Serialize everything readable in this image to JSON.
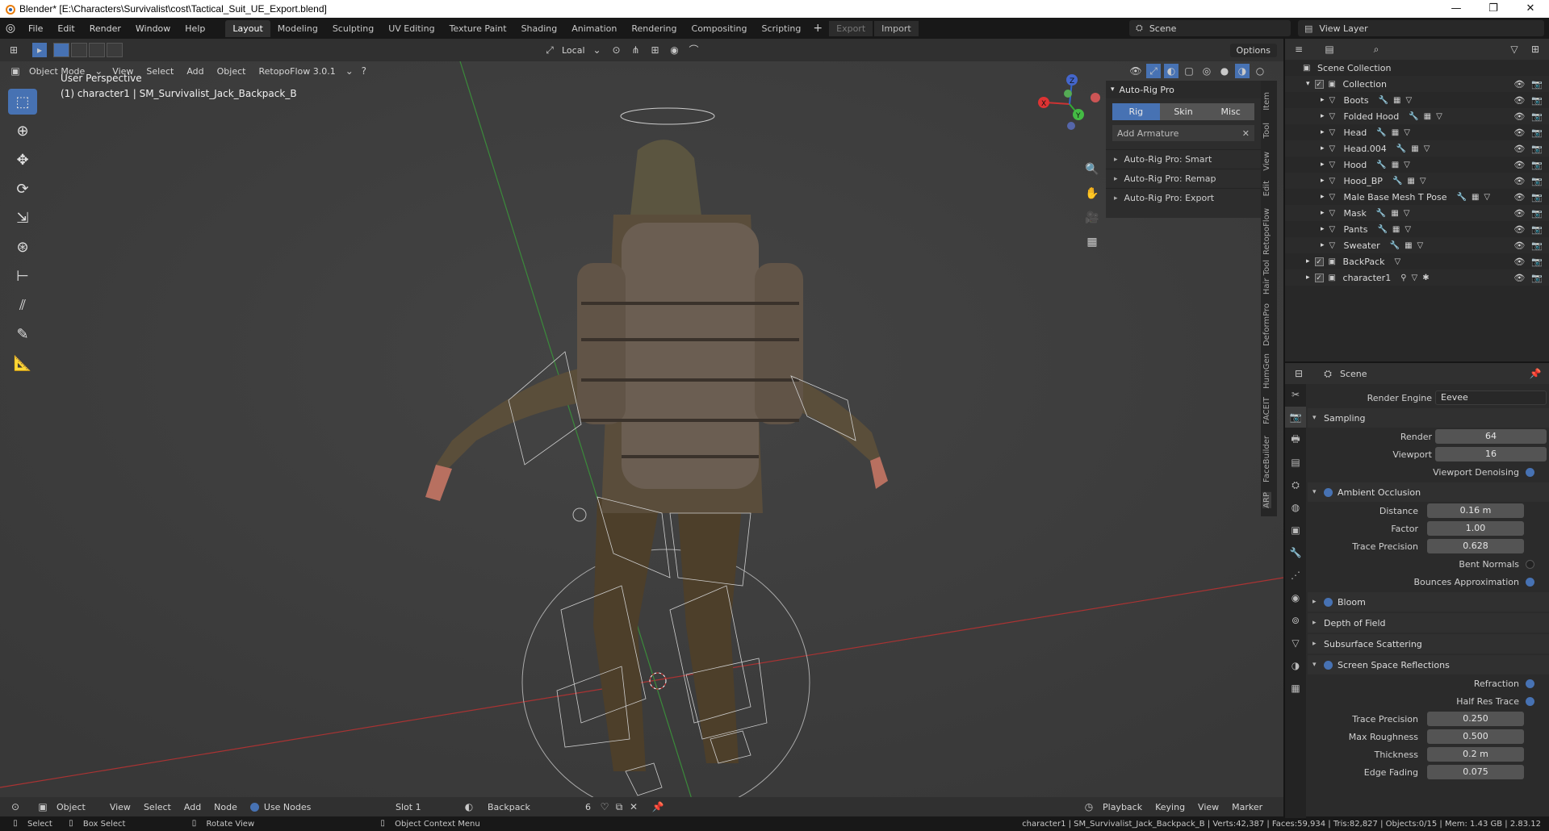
{
  "window": {
    "title": "Blender* [E:\\Characters\\Survivalist\\cost\\Tactical_Suit_UE_Export.blend]",
    "controls": [
      "—",
      "❐",
      "✕"
    ]
  },
  "menubar": {
    "menus": [
      "File",
      "Edit",
      "Render",
      "Window",
      "Help"
    ],
    "workspaces": [
      "Layout",
      "Modeling",
      "Sculpting",
      "UV Editing",
      "Texture Paint",
      "Shading",
      "Animation",
      "Rendering",
      "Compositing",
      "Scripting"
    ],
    "active_workspace": "Layout",
    "export_label": "Export",
    "import_label": "Import",
    "scene": "Scene",
    "view_layer": "View Layer"
  },
  "viewport_header": {
    "transform_orientation": "Local",
    "options": "Options",
    "mode": "Object Mode",
    "menus": [
      "View",
      "Select",
      "Add",
      "Object"
    ],
    "retopoflow": "RetopoFlow 3.0.1"
  },
  "viewport": {
    "perspective": "User Perspective",
    "active_object": "(1) character1 | SM_Survivalist_Jack_Backpack_B"
  },
  "npanel": {
    "title": "Auto-Rig Pro",
    "tabs": [
      "Rig",
      "Skin",
      "Misc"
    ],
    "active_tab": "Rig",
    "add_armature": "Add Armature",
    "subpanels": [
      "Auto-Rig Pro: Smart",
      "Auto-Rig Pro: Remap",
      "Auto-Rig Pro: Export"
    ],
    "side_tabs": [
      "Item",
      "Tool",
      "View",
      "Edit",
      "RetopoFlow",
      "Hair Tool",
      "DeformPro",
      "HumGen",
      "FACEIT",
      "FaceBuilder",
      "ARP"
    ]
  },
  "bottom_header": {
    "editor": "Object",
    "menus": [
      "View",
      "Select",
      "Add",
      "Node"
    ],
    "use_nodes": "Use Nodes",
    "slot": "Slot 1",
    "material": "Backpack",
    "users": "6",
    "playback": "Playback",
    "keying": "Keying",
    "view": "View",
    "marker": "Marker"
  },
  "statusbar": {
    "select": "Select",
    "box_select": "Box Select",
    "rotate_view": "Rotate View",
    "context_menu": "Object Context Menu",
    "stats": "character1 | SM_Survivalist_Jack_Backpack_B | Verts:42,387 | Faces:59,934 | Tris:82,827 | Objects:0/15 | Mem: 1.43 GB | 2.83.12"
  },
  "outliner": {
    "root": "Scene Collection",
    "collection": "Collection",
    "items": [
      {
        "name": "Boots"
      },
      {
        "name": "Folded Hood"
      },
      {
        "name": "Head"
      },
      {
        "name": "Head.004"
      },
      {
        "name": "Hood"
      },
      {
        "name": "Hood_BP"
      },
      {
        "name": "Male Base Mesh T Pose"
      },
      {
        "name": "Mask"
      },
      {
        "name": "Pants"
      },
      {
        "name": "Sweater"
      }
    ],
    "top_level": [
      {
        "name": "BackPack"
      },
      {
        "name": "character1"
      }
    ]
  },
  "properties": {
    "context": "Scene",
    "render_engine_label": "Render Engine",
    "render_engine": "Eevee",
    "sampling": {
      "title": "Sampling",
      "render_label": "Render",
      "render": "64",
      "viewport_label": "Viewport",
      "viewport": "16",
      "denoising_label": "Viewport Denoising"
    },
    "ambient_occlusion": {
      "title": "Ambient Occlusion",
      "distance_label": "Distance",
      "distance": "0.16 m",
      "factor_label": "Factor",
      "factor": "1.00",
      "trace_precision_label": "Trace Precision",
      "trace_precision": "0.628",
      "bent_normals_label": "Bent Normals",
      "bounces_label": "Bounces Approximation"
    },
    "panels": [
      "Bloom",
      "Depth of Field",
      "Subsurface Scattering"
    ],
    "ssr": {
      "title": "Screen Space Reflections",
      "refraction_label": "Refraction",
      "half_res_label": "Half Res Trace",
      "trace_precision_label": "Trace Precision",
      "trace_precision": "0.250",
      "max_roughness_label": "Max Roughness",
      "max_roughness": "0.500",
      "thickness_label": "Thickness",
      "thickness": "0.2 m",
      "edge_fading_label": "Edge Fading",
      "edge_fading": "0.075"
    }
  },
  "colors": {
    "accent": "#4772b3",
    "viewport_bg": "#3d3d3d",
    "axis_x": "#c0392b",
    "axis_y": "#2e8b2e"
  }
}
